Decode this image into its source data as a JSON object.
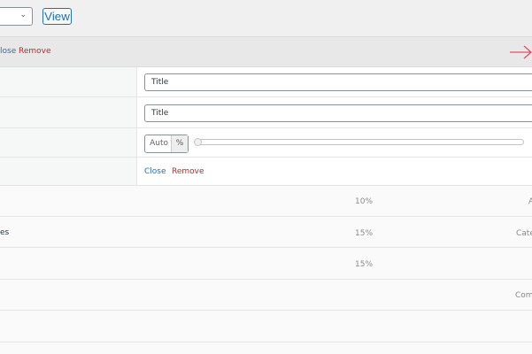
{
  "toolbar": {
    "view_label": "View",
    "select_chevron": "chevron-down-icon"
  },
  "header": {
    "close_label": "lose",
    "remove_label": "Remove",
    "arrow_icon": "arrow-right-icon",
    "arrow_color": "#e0506a"
  },
  "settings": {
    "field1_value": "Title",
    "field2_value": "Title",
    "width_auto": "Auto",
    "width_unit": "%",
    "width_slider": 0,
    "close_label": "Close",
    "remove_label": "Remove"
  },
  "table": {
    "rows": [
      {
        "label": "",
        "width": "10%",
        "type": "A"
      },
      {
        "label": "es",
        "width": "15%",
        "type": "Cate"
      },
      {
        "label": "",
        "width": "15%",
        "type": ""
      },
      {
        "label": "",
        "width": "",
        "type": "Com"
      },
      {
        "label": "",
        "width": "",
        "type": ""
      }
    ]
  }
}
